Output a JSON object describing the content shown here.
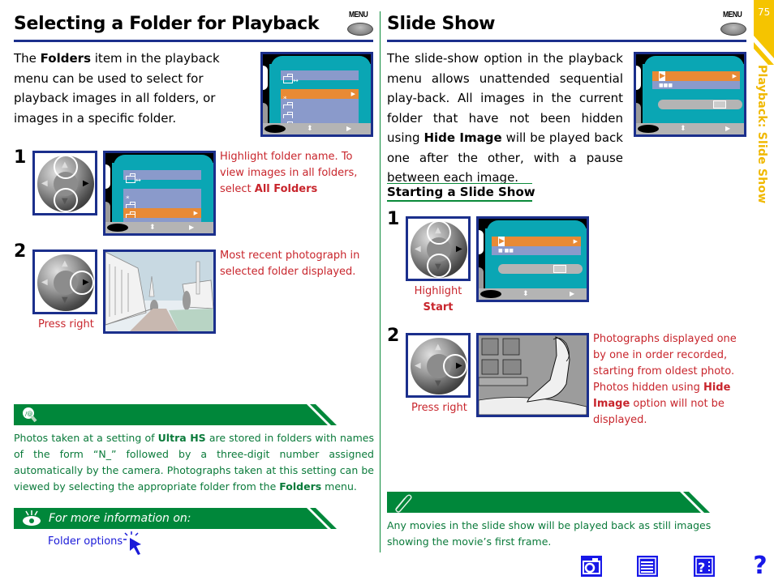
{
  "page": {
    "number": "75",
    "side_tab": "Playback: Slide Show",
    "colors": {
      "heading_rule": "#1b2f8c",
      "instruction_red": "#c8252c",
      "note_green": "#00873a",
      "side_tab_yellow": "#f0b800",
      "link_blue": "#1a1ad8",
      "lcd_teal": "#0aa6b4",
      "lcd_highlight": "#e88a35",
      "lcd_item": "#8a9acb"
    }
  },
  "left": {
    "title": "Selecting a Folder for Playback",
    "menu_label": "MENU",
    "intro": {
      "pre": "The ",
      "bold": "Folders",
      "post": " item in the playback menu can be used to select for playback images in all folders, or images in a specific folder."
    },
    "steps": [
      {
        "number": "1",
        "instruction_pre": "Highlight folder name.  To view images in all folders, select ",
        "instruction_bold": "All Folders",
        "dial_caption": ""
      },
      {
        "number": "2",
        "instruction": "Most recent photograph in selected folder displayed.",
        "dial_caption": "Press right"
      }
    ],
    "tip_note": {
      "icon": "lightbulb-icon",
      "text_pre": "Photos taken at a setting of ",
      "bold1": "Ultra HS",
      "text_mid": " are stored in folders with names of the form “N_” followed by a three-digit number assigned automatically by the camera.  Photographs taken at this setting can be viewed by selecting the appropriate folder from the ",
      "bold2": "Folders",
      "text_post": " menu."
    },
    "more_info": {
      "icon": "eye-icon",
      "title": "For more information on:",
      "link": "Folder options"
    }
  },
  "right": {
    "title": "Slide Show",
    "menu_label": "MENU",
    "intro": {
      "pre": "The slide-show option in the playback menu allows unattended sequential play-back. All images in the current folder that have not been hidden using ",
      "bold": "Hide Image",
      "post": " will be played back one after the other, with a pause between each image."
    },
    "subheading": "Starting a Slide Show",
    "steps": [
      {
        "number": "1",
        "caption_line1": "Highlight",
        "caption_bold": "Start"
      },
      {
        "number": "2",
        "caption": "Press right",
        "instruction_pre": "Photographs displayed one by one in order recorded, starting from oldest photo. Photos hidden using ",
        "instruction_bold": "Hide Image",
        "instruction_post": " option will not be displayed."
      }
    ],
    "note": {
      "icon": "paperclip-icon",
      "text": "Any movies in the slide show will be played back as still images showing the movie’s first frame."
    }
  },
  "nav": [
    {
      "name": "camera",
      "label": "camera-icon"
    },
    {
      "name": "menu-list",
      "label": "menu-list-icon"
    },
    {
      "name": "help-menu",
      "label": "help-menu-icon"
    },
    {
      "name": "help",
      "label": "help-icon"
    }
  ]
}
